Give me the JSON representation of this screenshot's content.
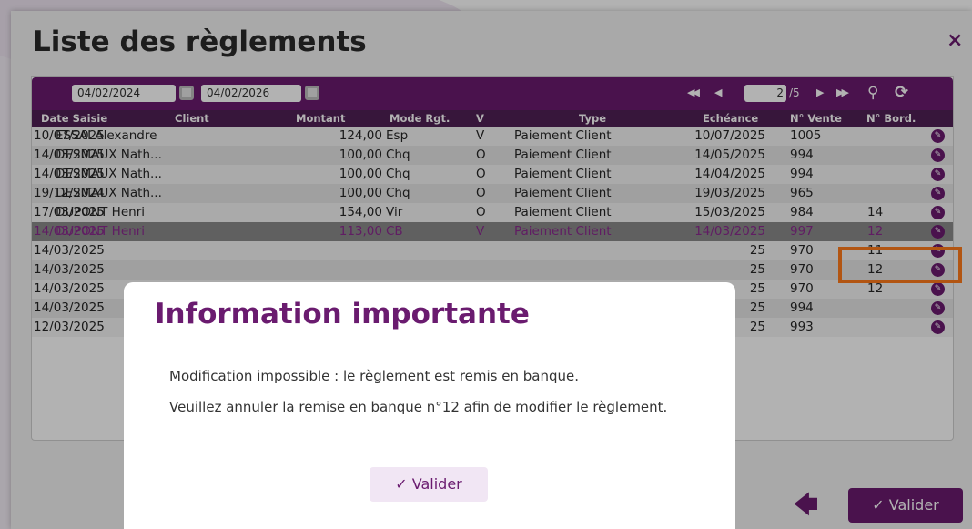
{
  "window": {
    "title": "Liste des règlements",
    "close_icon": "×"
  },
  "toolbar": {
    "date_from": "04/02/2024",
    "date_to": "04/02/2026",
    "first_icon": "◀◀",
    "prev_icon": "◀",
    "page": "2",
    "page_total": "/5",
    "next_icon": "▶",
    "last_icon": "▶▶",
    "search_icon": "⚲",
    "refresh_icon": "⟳"
  },
  "table": {
    "columns": [
      "Date Saisie",
      "Client",
      "Montant",
      "Mode Rgt.",
      "V",
      "Type",
      "Echéance",
      "N° Vente",
      "N° Bord."
    ],
    "rows": [
      [
        "10/07/2025",
        "ESSAI Alexandre",
        "124,00",
        "Esp",
        "V",
        "Paiement Client",
        "10/07/2025",
        "1005",
        ""
      ],
      [
        "14/03/2025",
        "DESMAUX Nath...",
        "100,00",
        "Chq",
        "O",
        "Paiement Client",
        "14/05/2025",
        "994",
        ""
      ],
      [
        "14/03/2025",
        "DESMAUX Nath...",
        "100,00",
        "Chq",
        "O",
        "Paiement Client",
        "14/04/2025",
        "994",
        ""
      ],
      [
        "19/12/2024",
        "DESMAUX Nath...",
        "100,00",
        "Chq",
        "O",
        "Paiement Client",
        "19/03/2025",
        "965",
        ""
      ],
      [
        "17/03/2025",
        "DUPONT Henri",
        "154,00",
        "Vir",
        "O",
        "Paiement Client",
        "15/03/2025",
        "984",
        "14"
      ],
      [
        "14/03/2025",
        "DUPONT Henri",
        "113,00",
        "CB",
        "V",
        "Paiement Client",
        "14/03/2025",
        "997",
        "12"
      ],
      [
        "14/03/2025",
        "",
        "",
        "",
        "",
        "",
        "25",
        "970",
        "11"
      ],
      [
        "14/03/2025",
        "",
        "",
        "",
        "",
        "",
        "25",
        "970",
        "12"
      ],
      [
        "14/03/2025",
        "",
        "",
        "",
        "",
        "",
        "25",
        "970",
        "12"
      ],
      [
        "14/03/2025",
        "",
        "",
        "",
        "",
        "",
        "25",
        "994",
        ""
      ],
      [
        "12/03/2025",
        "",
        "",
        "",
        "",
        "",
        "25",
        "993",
        ""
      ]
    ],
    "edit_icon": "✎"
  },
  "footer": {
    "back_icon": "🡄",
    "validate_label": "✓ Valider"
  },
  "modal": {
    "title": "Information importante",
    "line1": "Modification impossible : le règlement est remis en banque.",
    "line2": "Veuillez annuler la remise en banque n°12 afin de modifier le règlement.",
    "button": "✓  Valider"
  },
  "colors": {
    "accent": "#6a1b6f",
    "header": "#4f2055",
    "highlight": "#ff7a1a",
    "selected_row": "#8a8a8a"
  }
}
